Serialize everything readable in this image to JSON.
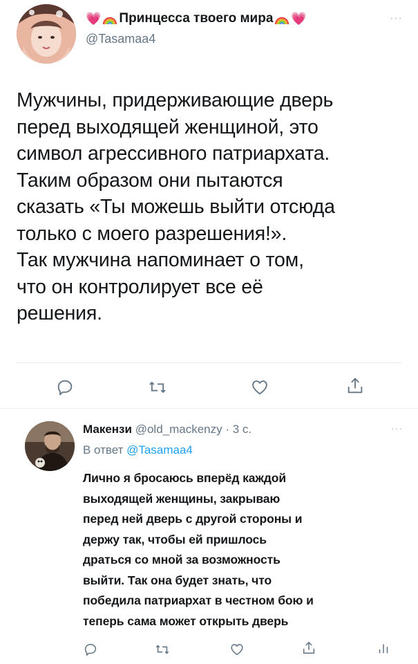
{
  "main_tweet": {
    "display_name": "Принцесса твоего мира",
    "handle": "@Tasamaa4",
    "more_label": "···",
    "text_lines": [
      "Мужчины, придерживающие дверь",
      "перед выходящей женщиной, это",
      "символ агрессивного патриархата.",
      "Таким образом они пытаются",
      "сказать «Ты можешь выйти отсюда",
      "только с моего разрешения!».",
      "Так мужчина напоминает о том,",
      "что он контролирует все её",
      "решения."
    ],
    "actions": [
      "reply-icon",
      "retweet-icon",
      "like-icon",
      "share-icon"
    ],
    "decorations": [
      "heart-icon",
      "rainbow-icon"
    ],
    "colors": {
      "heart": "#ff6fa8",
      "text": "#14171a",
      "muted": "#657786"
    }
  },
  "reply_tweet": {
    "display_name": "Макензи",
    "handle": "@old_mackenzy",
    "separator": " · ",
    "time": "3 с.",
    "more_label": "···",
    "replying_prefix": "В ответ ",
    "replying_handle": "@Tasamaa4",
    "text_lines": [
      "Лично я бросаюсь вперёд каждой",
      "выходящей женщины, закрываю",
      "перед ней дверь с другой стороны и",
      "держу так, чтобы ей пришлось",
      "драться со мной за возможность",
      "выйти. Так она будет знать, что",
      "победила патриархат в честном бою и",
      "теперь сама может открыть дверь"
    ],
    "actions": [
      "reply-icon",
      "retweet-icon",
      "like-icon",
      "share-icon",
      "analytics-icon"
    ],
    "colors": {
      "link": "#1da1f2",
      "muted": "#657786"
    }
  }
}
